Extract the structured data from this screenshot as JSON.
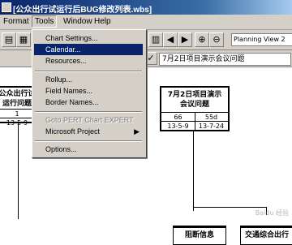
{
  "title": "[公众出行试运行后BUG修改列表.wbs]",
  "menubar": [
    "Format",
    "Tools",
    "Window",
    "Help"
  ],
  "toolbar": {
    "view_label": "Planning View 2"
  },
  "entry": {
    "value": "7月2日项目演示会议问题"
  },
  "tools_menu": [
    {
      "label": "Chart Settings...",
      "state": "normal"
    },
    {
      "label": "Calendar...",
      "state": "highlighted"
    },
    {
      "label": "Resources...",
      "state": "normal"
    },
    {
      "label": "Rollup...",
      "state": "normal"
    },
    {
      "label": "Field Names...",
      "state": "normal"
    },
    {
      "label": "Border Names...",
      "state": "normal"
    },
    {
      "label": "Goto PERT Chart EXPERT",
      "state": "disabled"
    },
    {
      "label": "Microsoft Project",
      "state": "submenu"
    },
    {
      "label": "Options...",
      "state": "normal"
    }
  ],
  "nodes": {
    "left": {
      "title": "公众出行试运行问题",
      "num": "1",
      "date": "13-5-9"
    },
    "center": {
      "title": "7月2日项目演示会议问题",
      "id": "66",
      "duration": "55d",
      "start": "13-5-9",
      "finish": "13-7-24"
    },
    "bottom1": {
      "title": "阻断信息"
    },
    "bottom2": {
      "title": "交通综合出行"
    }
  },
  "watermark": "Baidu 经验"
}
